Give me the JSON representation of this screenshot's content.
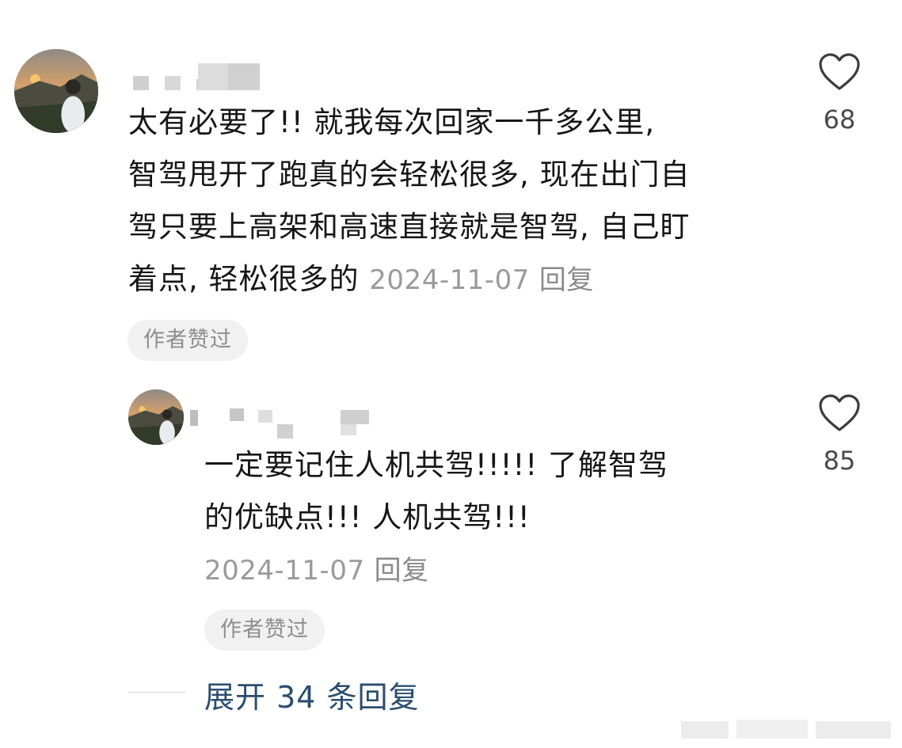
{
  "comments": [
    {
      "text_lines": [
        "太有必要了!! 就我每次回家一千多公里,",
        "智驾甩开了跑真的会轻松很多, 现在出门自",
        "驾只要上高架和高速直接就是智驾, 自己盯"
      ],
      "last_line_text": "着点, 轻松很多的",
      "date": "2024-11-07",
      "reply_label": "回复",
      "badge": "作者赞过",
      "likes": "68"
    }
  ],
  "replies": [
    {
      "text_lines": [
        "一定要记住人机共驾!!!!! 了解智驾",
        "的优缺点!!! 人机共驾!!!"
      ],
      "date": "2024-11-07",
      "reply_label": "回复",
      "badge": "作者赞过",
      "likes": "85"
    }
  ],
  "expand_replies": "展开 34 条回复",
  "colors": {
    "link_blue": "#2a4d6e",
    "meta_gray": "#9a9a9a",
    "badge_bg": "#f1f1f1"
  },
  "icons": {
    "like": "heart-outline-icon"
  }
}
